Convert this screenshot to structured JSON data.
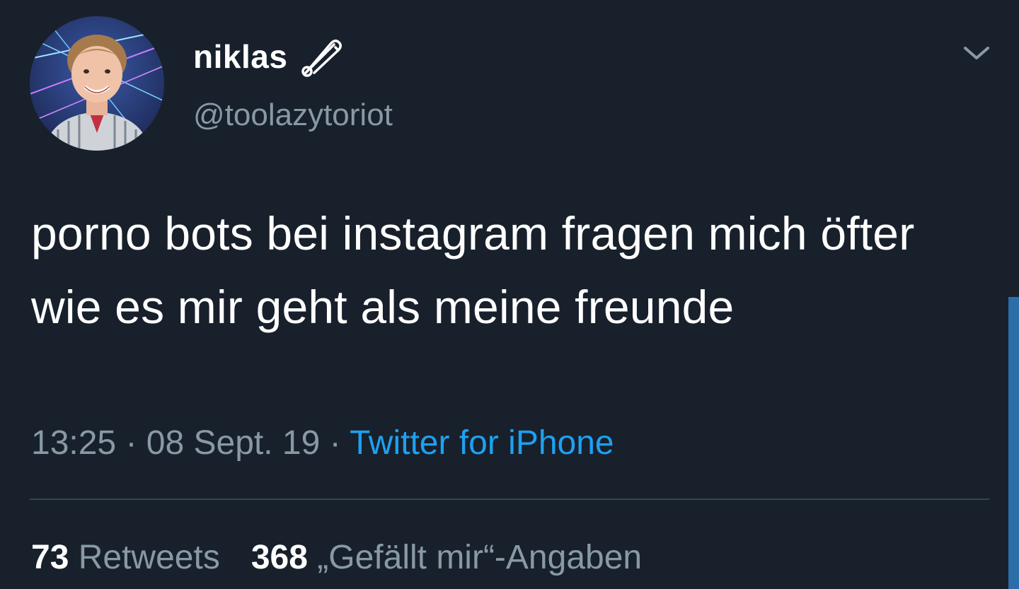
{
  "user": {
    "display_name": "niklas",
    "handle": "@toolazytoriot"
  },
  "tweet": {
    "text": "porno bots bei instagram fragen mich öfter wie es mir geht als meine freunde",
    "time": "13:25",
    "separator": " · ",
    "date": "08 Sept. 19",
    "source": "Twitter for iPhone"
  },
  "stats": {
    "retweets_count": "73",
    "retweets_label": "Retweets",
    "likes_count": "368",
    "likes_label": "„Gefällt mir“-Angaben"
  },
  "icons": {
    "badge": "safety-pin-icon",
    "menu": "chevron-down-icon"
  },
  "colors": {
    "background": "#18202b",
    "text": "#ffffff",
    "secondary_text": "#8899a6",
    "link": "#1da1f2",
    "divider": "#38444d"
  }
}
